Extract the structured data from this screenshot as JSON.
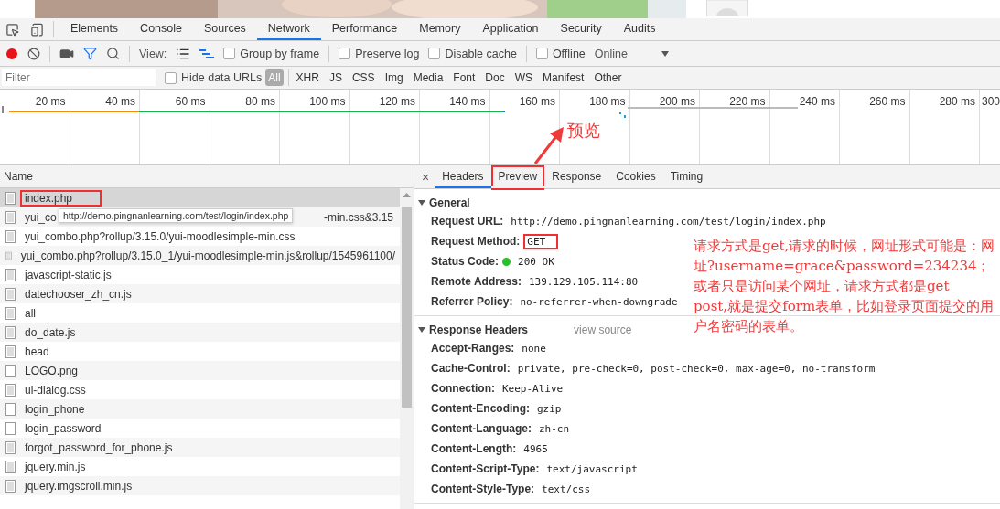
{
  "devtools_tabs": [
    {
      "label": "Elements",
      "selected": false
    },
    {
      "label": "Console",
      "selected": false
    },
    {
      "label": "Sources",
      "selected": false
    },
    {
      "label": "Network",
      "selected": true
    },
    {
      "label": "Performance",
      "selected": false
    },
    {
      "label": "Memory",
      "selected": false
    },
    {
      "label": "Application",
      "selected": false
    },
    {
      "label": "Security",
      "selected": false
    },
    {
      "label": "Audits",
      "selected": false
    }
  ],
  "toolbar": {
    "recording": true,
    "view_label": "View:",
    "checkboxes": [
      {
        "label": "Group by frame",
        "checked": false
      },
      {
        "label": "Preserve log",
        "checked": false
      },
      {
        "label": "Disable cache",
        "checked": false
      },
      {
        "label": "Offline",
        "checked": false
      }
    ],
    "throttle": "Online"
  },
  "filter": {
    "placeholder": "Filter",
    "hide_data_urls": {
      "label": "Hide data URLs",
      "checked": false
    },
    "types": [
      {
        "label": "All",
        "selected": true
      },
      {
        "label": "XHR",
        "selected": false
      },
      {
        "label": "JS",
        "selected": false
      },
      {
        "label": "CSS",
        "selected": false
      },
      {
        "label": "Img",
        "selected": false
      },
      {
        "label": "Media",
        "selected": false
      },
      {
        "label": "Font",
        "selected": false
      },
      {
        "label": "Doc",
        "selected": false
      },
      {
        "label": "WS",
        "selected": false
      },
      {
        "label": "Manifest",
        "selected": false
      },
      {
        "label": "Other",
        "selected": false
      }
    ]
  },
  "timeline": {
    "ticks": [
      "20 ms",
      "40 ms",
      "60 ms",
      "80 ms",
      "100 ms",
      "120 ms",
      "140 ms",
      "160 ms",
      "180 ms",
      "200 ms",
      "220 ms",
      "240 ms",
      "260 ms",
      "280 ms",
      "300"
    ]
  },
  "requests": {
    "header": "Name",
    "tooltip": "http://demo.pingnanlearning.com/test/login/index.php",
    "rows": [
      {
        "name": "index.php",
        "kind": "document",
        "selected": true,
        "boxed": true
      },
      {
        "name_parts": [
          "yui_co",
          "-min.css&3.15"
        ],
        "kind": "document",
        "selected": false
      },
      {
        "name": "yui_combo.php?rollup/3.15.0/yui-moodlesimple-min.css",
        "kind": "document",
        "selected": false,
        "boxed": false
      },
      {
        "name": "yui_combo.php?rollup/3.15.0_1/yui-moodlesimple-min.js&rollup/1545961100/",
        "kind": "document",
        "selected": false,
        "boxed": false
      },
      {
        "name": "javascript-static.js",
        "kind": "document",
        "selected": false,
        "boxed": false
      },
      {
        "name": "datechooser_zh_cn.js",
        "kind": "document",
        "selected": false,
        "boxed": false
      },
      {
        "name": "all",
        "kind": "document",
        "selected": false,
        "boxed": false
      },
      {
        "name": "do_date.js",
        "kind": "document",
        "selected": false,
        "boxed": false
      },
      {
        "name": "head",
        "kind": "document",
        "selected": false,
        "boxed": false
      },
      {
        "name": "LOGO.png",
        "selected": false,
        "boxed": false
      },
      {
        "name": "ui-dialog.css",
        "kind": "document",
        "selected": false,
        "boxed": false
      },
      {
        "name": "login_phone",
        "selected": false,
        "boxed": false
      },
      {
        "name": "login_password",
        "selected": false,
        "boxed": false
      },
      {
        "name": "forgot_password_for_phone.js",
        "kind": "document",
        "selected": false,
        "boxed": false
      },
      {
        "name": "jquery.min.js",
        "kind": "document",
        "selected": false,
        "boxed": false
      },
      {
        "name": "jquery.imgscroll.min.js",
        "kind": "document",
        "selected": false,
        "boxed": false
      }
    ]
  },
  "details": {
    "close": "×",
    "tabs": [
      {
        "label": "Headers",
        "selected": true,
        "boxed": false
      },
      {
        "label": "Preview",
        "selected": false,
        "boxed": true
      },
      {
        "label": "Response",
        "selected": false,
        "boxed": false
      },
      {
        "label": "Cookies",
        "selected": false,
        "boxed": false
      },
      {
        "label": "Timing",
        "selected": false,
        "boxed": false
      }
    ],
    "sections": [
      {
        "title": "General",
        "expanded": true,
        "rows": [
          {
            "key": "Request URL:",
            "value": "http://demo.pingnanlearning.com/test/login/index.php",
            "kind": "text",
            "boxed": false
          },
          {
            "key": "Request Method:",
            "value": "GET",
            "kind": "text",
            "boxed": true
          },
          {
            "key": "Status Code:",
            "value": "200 OK",
            "kind": "status",
            "boxed": false
          },
          {
            "key": "Remote Address:",
            "value": "139.129.105.114:80",
            "kind": "text",
            "boxed": false
          },
          {
            "key": "Referrer Policy:",
            "value": "no-referrer-when-downgrade",
            "kind": "text",
            "boxed": false
          }
        ]
      },
      {
        "title": "Response Headers",
        "expanded": true,
        "view_source": "view source",
        "rows": [
          {
            "key": "Accept-Ranges:",
            "value": "none",
            "kind": "text",
            "boxed": false
          },
          {
            "key": "Cache-Control:",
            "value": "private, pre-check=0, post-check=0, max-age=0, no-transform",
            "kind": "text",
            "boxed": false
          },
          {
            "key": "Connection:",
            "value": "Keep-Alive",
            "kind": "text",
            "boxed": false
          },
          {
            "key": "Content-Encoding:",
            "value": "gzip",
            "kind": "text",
            "boxed": false
          },
          {
            "key": "Content-Language:",
            "value": "zh-cn",
            "kind": "text",
            "boxed": false
          },
          {
            "key": "Content-Length:",
            "value": "4965",
            "kind": "text",
            "boxed": false
          },
          {
            "key": "Content-Script-Type:",
            "value": "text/javascript",
            "kind": "text",
            "boxed": false
          },
          {
            "key": "Content-Style-Type:",
            "value": "text/css",
            "kind": "text",
            "boxed": false
          }
        ]
      }
    ]
  },
  "annotations": {
    "label": "预览",
    "note": [
      "请求方式是get,请求的时候，网址形式可能是：网址?username=grace&password=234234；或者只是访问某个网址，请求方式都是get",
      "post,就是提交form表单，比如登录页面提交的用户名密码的表单。"
    ]
  }
}
